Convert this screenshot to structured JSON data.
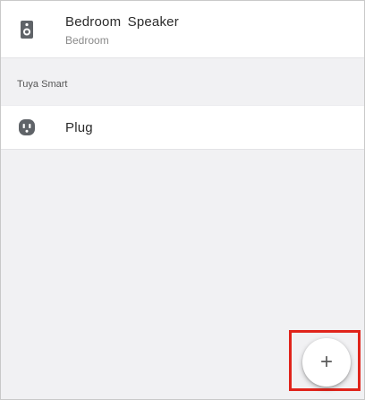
{
  "devices_top": [
    {
      "name": "Bedroom  Speaker",
      "room": "Bedroom",
      "icon": "speaker-icon"
    }
  ],
  "section": {
    "title": "Tuya Smart"
  },
  "devices_section": [
    {
      "name": "Plug",
      "icon": "plug-icon"
    }
  ],
  "fab": {
    "symbol": "+",
    "icon": "plus-icon"
  },
  "colors": {
    "highlight": "#e0241b",
    "icon": "#5f6368",
    "background": "#f1f1f3"
  }
}
